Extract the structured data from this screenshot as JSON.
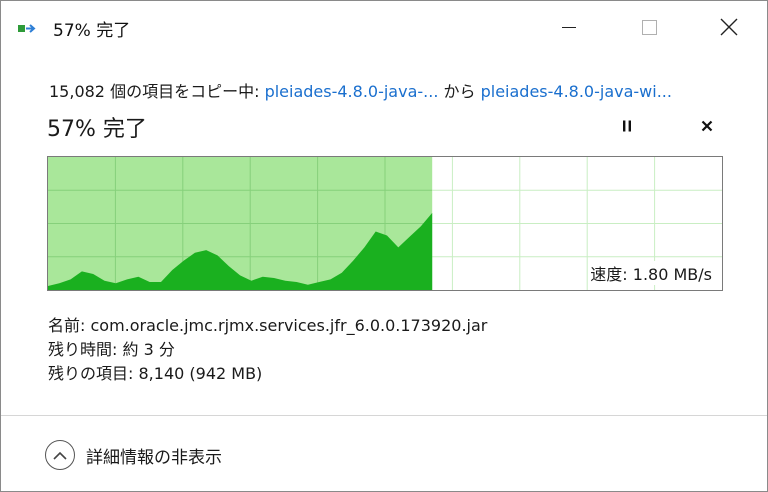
{
  "window": {
    "title": "57% 完了"
  },
  "header": {
    "copy_count": "15,082",
    "copy_mid": " 個の項目をコピー中: ",
    "source_link": "pleiades-4.8.0-java-...",
    "from_text": " から ",
    "dest_link": "pleiades-4.8.0-java-wi...",
    "percent_text": "57% 完了"
  },
  "progress": {
    "fraction": 0.57,
    "speed_text": "速度: 1.80 MB/s",
    "speed_history": [
      0.03,
      0.05,
      0.08,
      0.14,
      0.12,
      0.07,
      0.05,
      0.08,
      0.1,
      0.06,
      0.06,
      0.15,
      0.22,
      0.28,
      0.3,
      0.26,
      0.18,
      0.11,
      0.07,
      0.1,
      0.09,
      0.07,
      0.06,
      0.04,
      0.06,
      0.08,
      0.13,
      0.22,
      0.32,
      0.44,
      0.41,
      0.32,
      0.4,
      0.48,
      0.58
    ],
    "colors": {
      "fill_light": "#a9e79a",
      "fill_dark": "#1ab01f",
      "grid_done": "#86d07b",
      "grid_todo": "#c9eec3"
    }
  },
  "details": {
    "name_label": "名前:",
    "name_value": "com.oracle.jmc.rjmx.services.jfr_6.0.0.173920.jar",
    "time_label": "残り時間:",
    "time_value": "約 3 分",
    "items_label": "残りの項目:",
    "items_value": "8,140 (942 MB)"
  },
  "footer": {
    "toggle_label": "詳細情報の非表示",
    "icon": "chevron-up-icon"
  }
}
